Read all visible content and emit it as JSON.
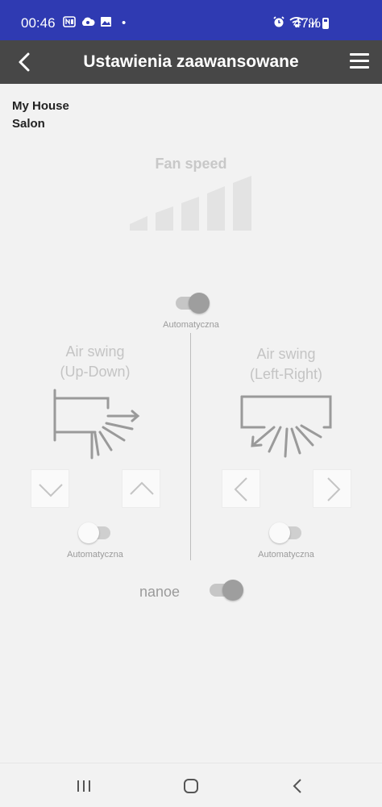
{
  "status_bar": {
    "time": "00:46",
    "battery": "47%",
    "dot": "•",
    "left_icons": [
      "nfc-icon",
      "cloud-icon",
      "image-icon"
    ],
    "right_icons": [
      "alarm-icon",
      "wifi-icon",
      "signal-icon"
    ]
  },
  "app_bar": {
    "title": "Ustawienia zaawansowane"
  },
  "location": {
    "home": "My House",
    "room": "Salon"
  },
  "fan_speed": {
    "label": "Fan speed",
    "levels": 5,
    "selected_level": 0
  },
  "auto_mode": {
    "label": "Automatyczna",
    "on": true
  },
  "swing_up_down": {
    "title_line1": "Air swing",
    "title_line2": "(Up-Down)",
    "auto_label": "Automatyczna",
    "auto_on": false
  },
  "swing_left_right": {
    "title_line1": "Air swing",
    "title_line2": "(Left-Right)",
    "auto_label": "Automatyczna",
    "auto_on": false
  },
  "nanoe": {
    "label": "nanoe",
    "on": true
  },
  "colors": {
    "status_bar": "#2f3ab2",
    "app_bar": "#474747",
    "background": "#f2f2f2",
    "disabled_text": "#c4c4c4"
  }
}
